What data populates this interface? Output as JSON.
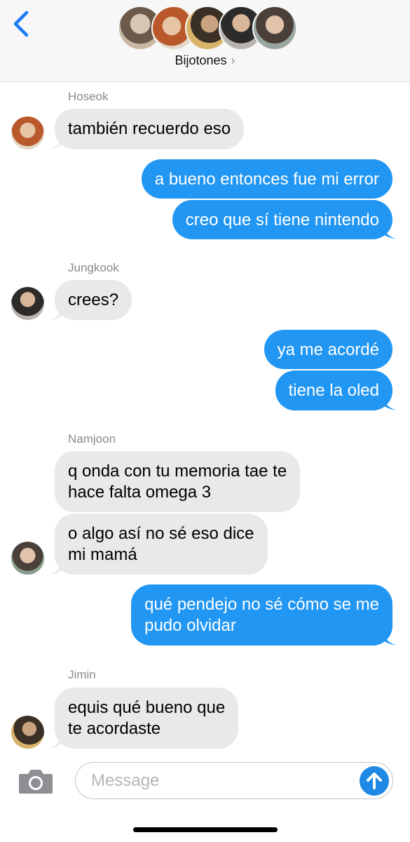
{
  "header": {
    "group_name": "Bijotones",
    "chevron": "›",
    "avatar_count": 5
  },
  "messages": [
    {
      "type": "sender",
      "name": "Hoseok"
    },
    {
      "type": "in",
      "text": "también recuerdo eso"
    },
    {
      "type": "out",
      "text": "a bueno entonces fue mi error"
    },
    {
      "type": "out",
      "text": "creo que sí tiene nintendo"
    },
    {
      "type": "sender",
      "name": "Jungkook"
    },
    {
      "type": "in",
      "text": "crees?"
    },
    {
      "type": "out",
      "text": "ya me acordé"
    },
    {
      "type": "out",
      "text": "tiene la oled"
    },
    {
      "type": "sender",
      "name": "Namjoon"
    },
    {
      "type": "in",
      "text": "q onda con tu memoria tae te\nhace falta omega 3"
    },
    {
      "type": "in",
      "text": "o algo así no sé eso dice\nmi mamá"
    },
    {
      "type": "out",
      "text": "qué pendejo no sé cómo se me\npudo olvidar"
    },
    {
      "type": "sender",
      "name": "Jimin"
    },
    {
      "type": "in",
      "text": "equis qué bueno que\nte acordaste"
    }
  ],
  "input": {
    "placeholder": "Message"
  },
  "icons": {
    "back": "chevron-left-icon",
    "camera": "camera-icon",
    "send": "arrow-up-icon"
  },
  "colors": {
    "accent": "#2196f3",
    "incoming_bubble": "#e9e9eb",
    "outgoing_bubble": "#2196f3"
  }
}
